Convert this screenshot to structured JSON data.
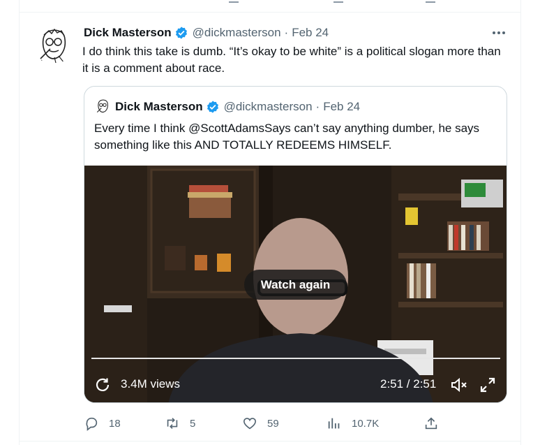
{
  "tweet": {
    "author": {
      "display_name": "Dick Masterson",
      "handle": "@dickmasterson",
      "verified": true
    },
    "date": "Feb 24",
    "text": "I do think this take is dumb. “It’s okay to be white” is a political slogan more than it is a comment about race.",
    "more_icon": "more-dots-icon",
    "quote": {
      "author": {
        "display_name": "Dick Masterson",
        "handle": "@dickmasterson",
        "verified": true
      },
      "date": "Feb 24",
      "text": "Every time I think @ScottAdamsSays can’t say anything dumber, he says something like this AND TOTALLY REDEEMS HIMSELF.",
      "video": {
        "overlay_label": "Watch again",
        "views": "3.4M views",
        "time": "2:51 / 2:51",
        "progress": 1.0,
        "icons": [
          "replay-icon",
          "volume-icon",
          "fullscreen-icon"
        ]
      }
    },
    "actions": {
      "replies": "18",
      "retweets": "5",
      "likes": "59",
      "views": "10.7K"
    }
  },
  "colors": {
    "text_primary": "#0f1419",
    "text_secondary": "#536471",
    "verified_blue": "#1d9bf0",
    "border": "#cfd9de"
  }
}
